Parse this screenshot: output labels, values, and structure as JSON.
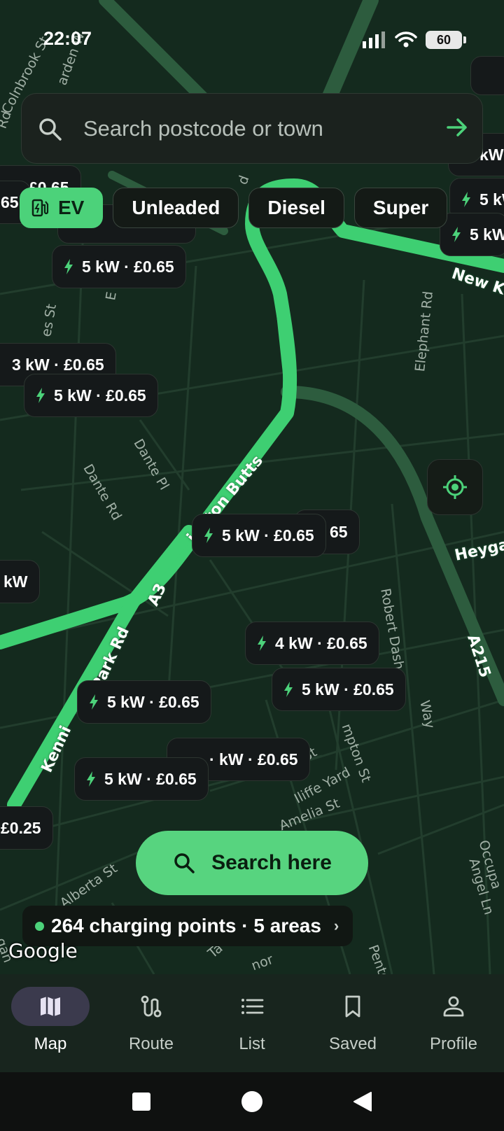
{
  "status_bar": {
    "time": "22:07",
    "battery": "60"
  },
  "search": {
    "placeholder": "Search postcode or town"
  },
  "fuel_chips": [
    {
      "label": "EV",
      "active": true
    },
    {
      "label": "Unleaded",
      "active": false
    },
    {
      "label": "Diesel",
      "active": false
    },
    {
      "label": "Super",
      "active": false
    }
  ],
  "map": {
    "street_labels": [
      "Colnbrook St",
      "arden W",
      "Rd",
      "Dante Pl",
      "Dante Rd",
      "es St",
      "E",
      "Elephant Rd",
      "New K",
      "ington Butts",
      "Heyga",
      "A3",
      "Park Rd",
      "Kenni",
      "Robert Dash",
      "Way",
      "A215",
      "Iliffe Yard",
      "mpton St",
      "St",
      "Amelia St",
      "Alberta St",
      "Occupa",
      "Angel Ln",
      "Penton",
      "Ta",
      "nor",
      "gan",
      "d"
    ],
    "pins": [
      {
        "label": "5 kW · £0.65"
      },
      {
        "label": "3 kW · £0.65"
      },
      {
        "label": "5 kW · £0.65"
      },
      {
        "label": "5 kW · £0.65"
      },
      {
        "label": "4 kW · £0.65"
      },
      {
        "label": "5 kW · £0.65"
      },
      {
        "label": "5 kW · £0.65"
      },
      {
        "label": "5 kW · £0.65"
      }
    ],
    "partial_pins": [
      "£0.65",
      "65",
      "kW",
      "£0.25",
      "5 kW",
      "5 kW",
      "kW",
      "kW",
      "65",
      "· kW · £0.65",
      "5 kW · £0.65"
    ],
    "accent_color": "#4cd27a"
  },
  "search_here": {
    "label": "Search here"
  },
  "summary": {
    "text": "264 charging points · 5 areas",
    "chevron": "›"
  },
  "attribution": "Google",
  "tabs": [
    {
      "label": "Map",
      "icon": "map-icon",
      "active": true
    },
    {
      "label": "Route",
      "icon": "route-icon",
      "active": false
    },
    {
      "label": "List",
      "icon": "list-icon",
      "active": false
    },
    {
      "label": "Saved",
      "icon": "bookmark-icon",
      "active": false
    },
    {
      "label": "Profile",
      "icon": "person-icon",
      "active": false
    }
  ]
}
